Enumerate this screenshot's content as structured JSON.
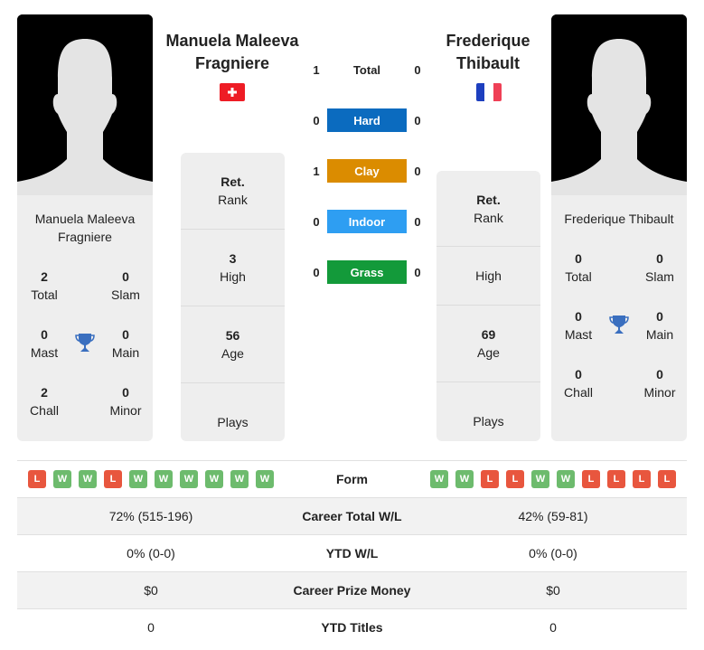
{
  "player_left": {
    "header_name_line1": "Manuela Maleeva",
    "header_name_line2": "Fragniere",
    "flag": "switzerland-flag",
    "card_name_line1": "Manuela Maleeva",
    "card_name_line2": "Fragniere",
    "titles": {
      "total": {
        "value": "2",
        "label": "Total"
      },
      "slam": {
        "value": "0",
        "label": "Slam"
      },
      "mast": {
        "value": "0",
        "label": "Mast"
      },
      "main": {
        "value": "0",
        "label": "Main"
      },
      "chall": {
        "value": "2",
        "label": "Chall"
      },
      "minor": {
        "value": "0",
        "label": "Minor"
      }
    },
    "info": {
      "rank": {
        "value": "Ret.",
        "label": "Rank"
      },
      "high": {
        "value": "3",
        "label": "High"
      },
      "age": {
        "value": "56",
        "label": "Age"
      },
      "plays": {
        "value": "",
        "label": "Plays"
      }
    }
  },
  "player_right": {
    "header_name_line1": "Frederique",
    "header_name_line2": "Thibault",
    "flag": "france-flag",
    "card_name_line1": "Frederique Thibault",
    "titles": {
      "total": {
        "value": "0",
        "label": "Total"
      },
      "slam": {
        "value": "0",
        "label": "Slam"
      },
      "mast": {
        "value": "0",
        "label": "Mast"
      },
      "main": {
        "value": "0",
        "label": "Main"
      },
      "chall": {
        "value": "0",
        "label": "Chall"
      },
      "minor": {
        "value": "0",
        "label": "Minor"
      }
    },
    "info": {
      "rank": {
        "value": "Ret.",
        "label": "Rank"
      },
      "high": {
        "value": "",
        "label": "High"
      },
      "age": {
        "value": "69",
        "label": "Age"
      },
      "plays": {
        "value": "",
        "label": "Plays"
      }
    }
  },
  "h2h": {
    "total": {
      "label": "Total",
      "left": "1",
      "right": "0"
    },
    "surfaces": [
      {
        "label": "Hard",
        "left": "0",
        "right": "0",
        "color": "#0b6bbf"
      },
      {
        "label": "Clay",
        "left": "1",
        "right": "0",
        "color": "#db8c00"
      },
      {
        "label": "Indoor",
        "left": "0",
        "right": "0",
        "color": "#2e9ef2"
      },
      {
        "label": "Grass",
        "left": "0",
        "right": "0",
        "color": "#139a3a"
      }
    ]
  },
  "comparison": {
    "form": {
      "label": "Form",
      "left": [
        "L",
        "W",
        "W",
        "L",
        "W",
        "W",
        "W",
        "W",
        "W",
        "W"
      ],
      "right": [
        "W",
        "W",
        "L",
        "L",
        "W",
        "W",
        "L",
        "L",
        "L",
        "L"
      ]
    },
    "rows": [
      {
        "label": "Career Total W/L",
        "left": "72% (515-196)",
        "right": "42% (59-81)"
      },
      {
        "label": "YTD W/L",
        "left": "0% (0-0)",
        "right": "0% (0-0)"
      },
      {
        "label": "Career Prize Money",
        "left": "$0",
        "right": "$0"
      },
      {
        "label": "YTD Titles",
        "left": "0",
        "right": "0"
      }
    ]
  }
}
